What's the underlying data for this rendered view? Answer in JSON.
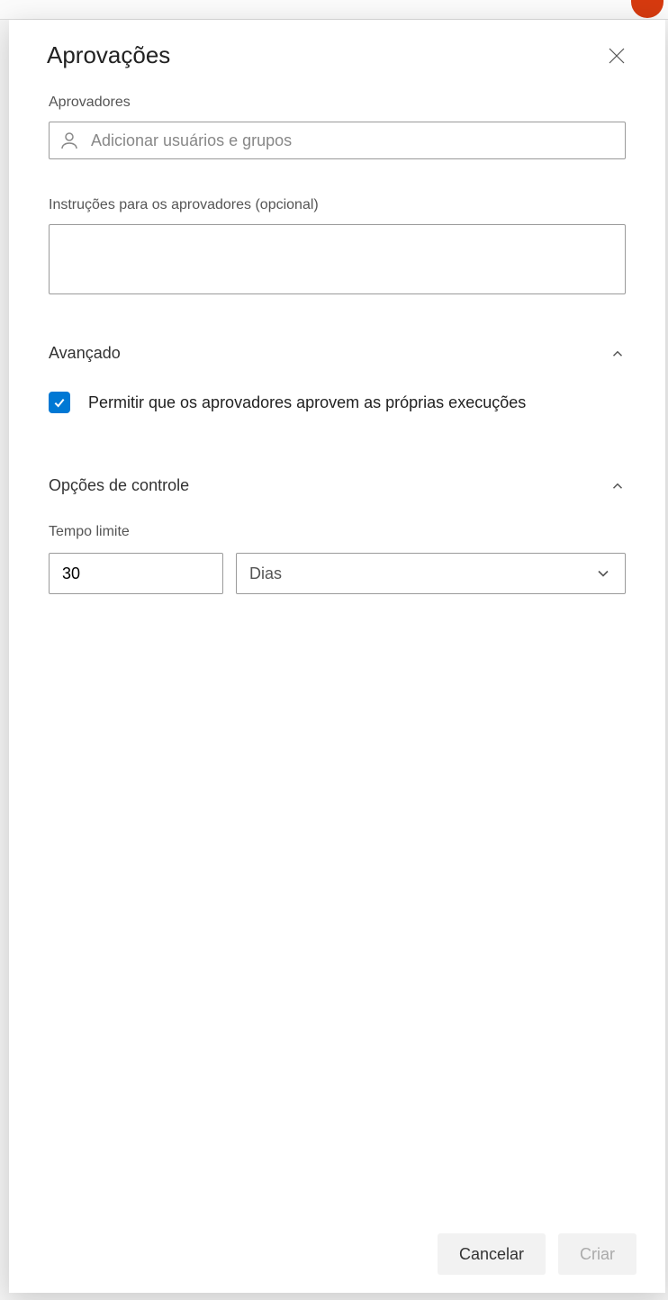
{
  "panel": {
    "title": "Aprovações"
  },
  "approvers": {
    "label": "Aprovadores",
    "placeholder": "Adicionar usuários e grupos"
  },
  "instructions": {
    "label": "Instruções para os aprovadores (opcional)",
    "value": ""
  },
  "advanced": {
    "title": "Avançado",
    "allow_self_approve": "Permitir que os aprovadores aprovem as próprias execuções",
    "allow_self_approve_checked": true
  },
  "control_options": {
    "title": "Opções de controle",
    "timeout_label": "Tempo limite",
    "timeout_value": "30",
    "timeout_unit": "Dias"
  },
  "footer": {
    "cancel": "Cancelar",
    "create": "Criar"
  }
}
